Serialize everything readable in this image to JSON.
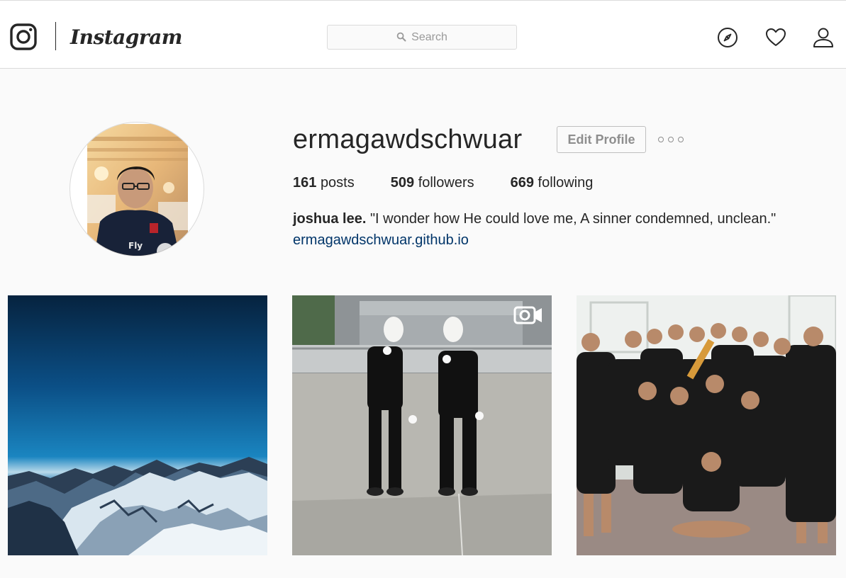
{
  "nav": {
    "wordmark": "Instagram",
    "search_placeholder": "Search",
    "icons": [
      "instagram-glyph-icon",
      "compass-icon",
      "heart-icon",
      "user-icon",
      "search-icon"
    ]
  },
  "profile": {
    "username": "ermagawdschwuar",
    "edit_button": "Edit Profile",
    "stats": {
      "posts_count": "161",
      "posts_label": "posts",
      "followers_count": "509",
      "followers_label": "followers",
      "following_count": "669",
      "following_label": "following"
    },
    "full_name": "joshua lee.",
    "bio": "\"I wonder how He could love me, A sinner condemned, unclean.\"",
    "website": "ermagawdschwuar.github.io"
  },
  "posts": [
    {
      "subject": "snowy mountain range under blue sky",
      "type": "photo"
    },
    {
      "subject": "two people in white masks on rooftop",
      "type": "video"
    },
    {
      "subject": "group photo in black shirts",
      "type": "photo"
    }
  ],
  "colors": {
    "text": "#262626",
    "muted": "#8e8e8e",
    "link": "#003569",
    "border": "#dbdbdb",
    "background": "#fafafa"
  }
}
